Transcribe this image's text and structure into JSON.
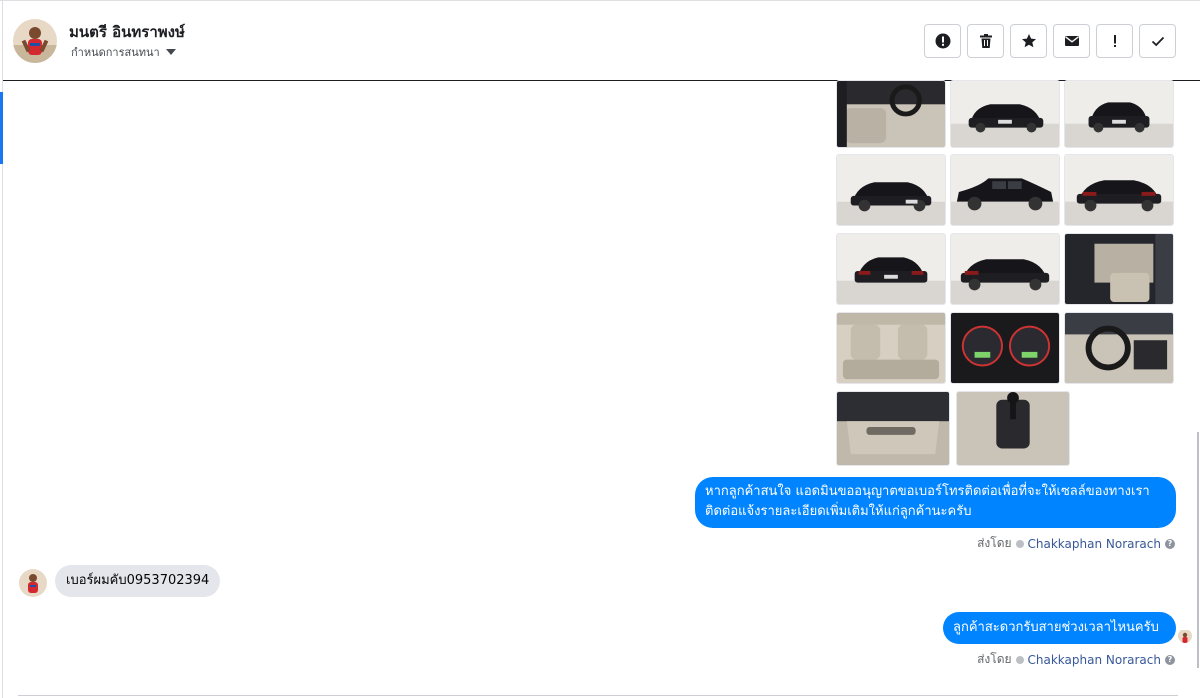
{
  "header": {
    "contact_name": "มนตรี อินทราพงษ์",
    "assign_label": "กำหนดการสนทนา"
  },
  "toolbar": {
    "buttons": [
      {
        "name": "report-spam",
        "icon": "alert-circle-icon"
      },
      {
        "name": "delete",
        "icon": "trash-icon"
      },
      {
        "name": "star",
        "icon": "star-icon"
      },
      {
        "name": "mark-unread",
        "icon": "envelope-icon"
      },
      {
        "name": "mark-important",
        "icon": "exclamation-icon"
      },
      {
        "name": "mark-done",
        "icon": "checkmark-icon"
      }
    ]
  },
  "photos": {
    "count": 14,
    "subject": "black sedan car and interior photos"
  },
  "messages": [
    {
      "direction": "outgoing",
      "text": "หากลูกค้าสนใจ แอดมินขออนุญาตขอเบอร์โทรติดต่อเพื่อที่จะให้เซลล์ของทางเราติดต่อแจ้งรายละเอียดเพิ่มเติมให้แก่ลูกค้านะครับ",
      "sent_by_label": "ส่งโดย",
      "agent": "Chakkaphan Norarach"
    },
    {
      "direction": "incoming",
      "text": "เบอร์ผมคับ0953702394"
    },
    {
      "direction": "outgoing",
      "text": "ลูกค้าสะดวกรับสายช่วงเวลาไหนครับ",
      "sent_by_label": "ส่งโดย",
      "agent": "Chakkaphan Norarach"
    }
  ],
  "colors": {
    "outgoing_bubble": "#0084ff",
    "incoming_bubble": "#e4e6eb",
    "agent_link": "#385898",
    "accent": "#1877f2"
  }
}
